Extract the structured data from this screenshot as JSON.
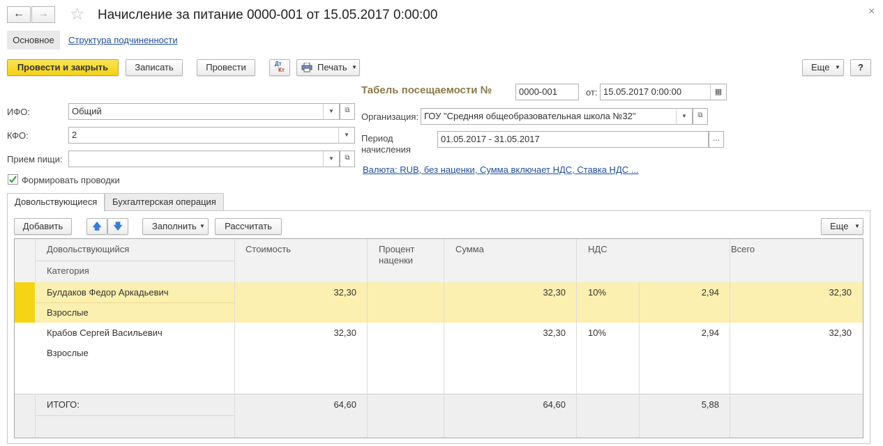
{
  "window": {
    "title": "Начисление за питание 0000-001 от 15.05.2017 0:00:00",
    "close_glyph": "×"
  },
  "nav": {
    "main": "Основное",
    "structure": "Структура подчиненности"
  },
  "toolbar": {
    "post_close": "Провести и закрыть",
    "save": "Записать",
    "post": "Провести",
    "dtkt_top": "Дт",
    "dtkt_bottom": "Кт",
    "print": "Печать",
    "more": "Еще",
    "help": "?"
  },
  "form": {
    "tabel_label": "Табель посещаемости №",
    "tabel_number": "0000-001",
    "from_label": "от:",
    "tabel_date": "15.05.2017  0:00:00",
    "ifo_label": "ИФО:",
    "ifo_value": "Общий",
    "kfo_label": "КФО:",
    "kfo_value": "2",
    "meal_label": "Прием пищи:",
    "meal_value": "",
    "org_label": "Организация:",
    "org_value": "ГОУ \"Средняя общеобразовательная школа №32\"",
    "period_label_1": "Период",
    "period_label_2": "начисления",
    "period_value": "01.05.2017 - 31.05.2017",
    "period_btn": "...",
    "currency_link": "Валюта: RUB, без наценки, Сумма включает НДС, Ставка НДС ...",
    "checkbox_label": "Формировать проводки",
    "checkbox_checked": true
  },
  "tabs": [
    {
      "label": "Довольствующиеся",
      "active": true
    },
    {
      "label": "Бухгалтерская операция",
      "active": false
    }
  ],
  "table_toolbar": {
    "add": "Добавить",
    "fill": "Заполнить",
    "calc": "Рассчитать",
    "more": "Еще"
  },
  "table": {
    "headers": {
      "person": "Довольствующийся",
      "category": "Категория",
      "cost": "Стоимость",
      "markup_1": "Процент",
      "markup_2": "наценки",
      "sum": "Сумма",
      "vat": "НДС",
      "total": "Всего"
    },
    "rows": [
      {
        "person": "Булдаков Федор Аркадьевич",
        "category": "Взрослые",
        "cost": "32,30",
        "markup": "",
        "sum": "32,30",
        "vat_rate": "10%",
        "vat_sum": "2,94",
        "total": "32,30",
        "selected": true
      },
      {
        "person": "Крабов Сергей Васильевич",
        "category": "Взрослые",
        "cost": "32,30",
        "markup": "",
        "sum": "32,30",
        "vat_rate": "10%",
        "vat_sum": "2,94",
        "total": "32,30",
        "selected": false
      }
    ],
    "footer": {
      "label": "ИТОГО:",
      "cost": "64,60",
      "sum": "64,60",
      "vat_sum": "5,88"
    }
  },
  "colors": {
    "accent_yellow": "#f3cf15",
    "selected_row": "#fbf0b0",
    "selection_marker": "#f5d416",
    "link": "#1f4e9e",
    "footer_bg": "#efefef"
  }
}
